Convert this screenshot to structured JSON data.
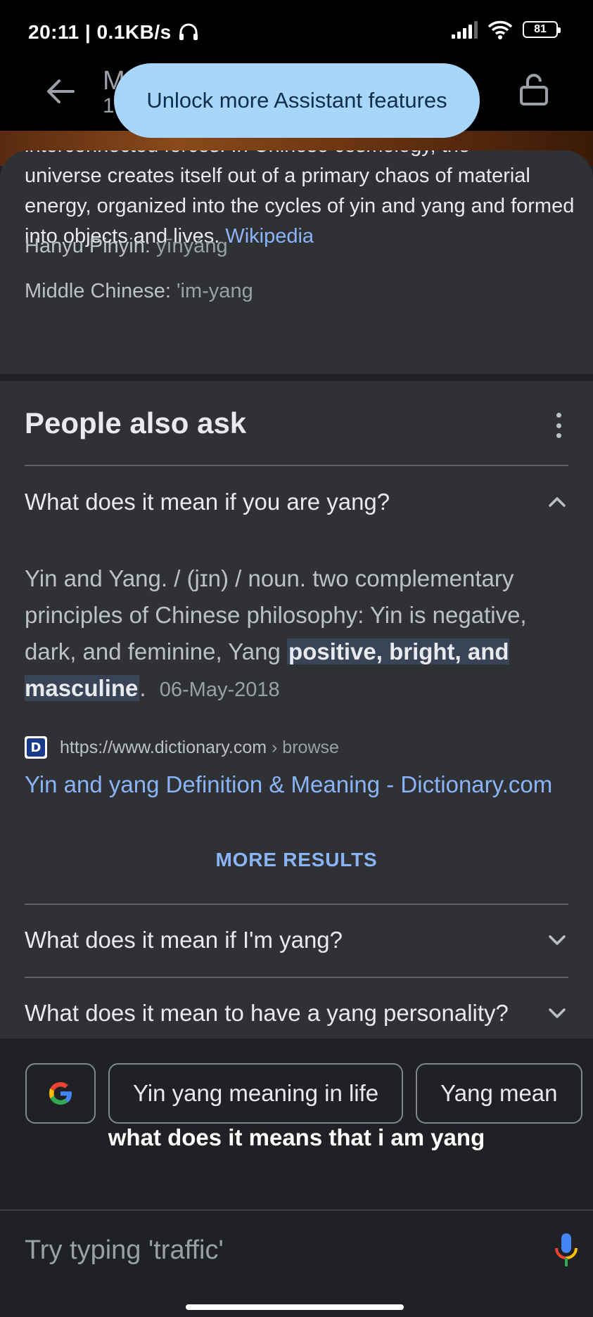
{
  "status_bar": {
    "text": "20:11 | 0.1KB/s",
    "battery": "81"
  },
  "app_bar": {
    "title_fragment": "M",
    "subtitle_fragment": "1"
  },
  "banner": {
    "label": "Unlock more Assistant features"
  },
  "knowledge_card": {
    "description_cutoff": "interconnected forces. In Chinese cosmology, the",
    "description": "universe creates itself out of a primary chaos of material energy, organized into the cycles of yin and yang and formed into objects and lives.",
    "source_link": "Wikipedia",
    "hanyu_label": "Hanyu Pinyin:",
    "hanyu_value": "yīnyáng",
    "middle_label": "Middle Chinese:",
    "middle_value": "'im-yang"
  },
  "people_also_ask": {
    "title": "People also ask",
    "expanded_question": "What does it mean if you are yang?",
    "answer_plain": "Yin and Yang. / (jɪn) / noun. two complementary principles of Chinese philosophy: Yin is negative, dark, and feminine, Yang",
    "answer_highlight": "positive, bright, and masculine",
    "answer_end": ".",
    "answer_date": "06-May-2018",
    "source_url": "https://www.dictionary.com",
    "source_crumb": " › browse",
    "result_title": "Yin and yang Definition & Meaning - Dictionary.com",
    "more_results": "MORE RESULTS",
    "questions": [
      "What does it mean if I'm yang?",
      "What does it mean to have a yang personality?"
    ]
  },
  "assistant": {
    "chips": [
      "Yin yang meaning in life",
      "Yang mean"
    ],
    "query": "what does it means that i am yang",
    "input_placeholder": "Try typing 'traffic'"
  },
  "icons": {
    "back": "back-arrow-icon",
    "lock": "lock-icon",
    "google": "google-g-icon",
    "mic": "mic-icon"
  },
  "colors": {
    "accent_link": "#8ab4f8",
    "banner_bg": "#a8d5fa",
    "card_bg": "#303134",
    "highlight_bg": "#394457"
  }
}
